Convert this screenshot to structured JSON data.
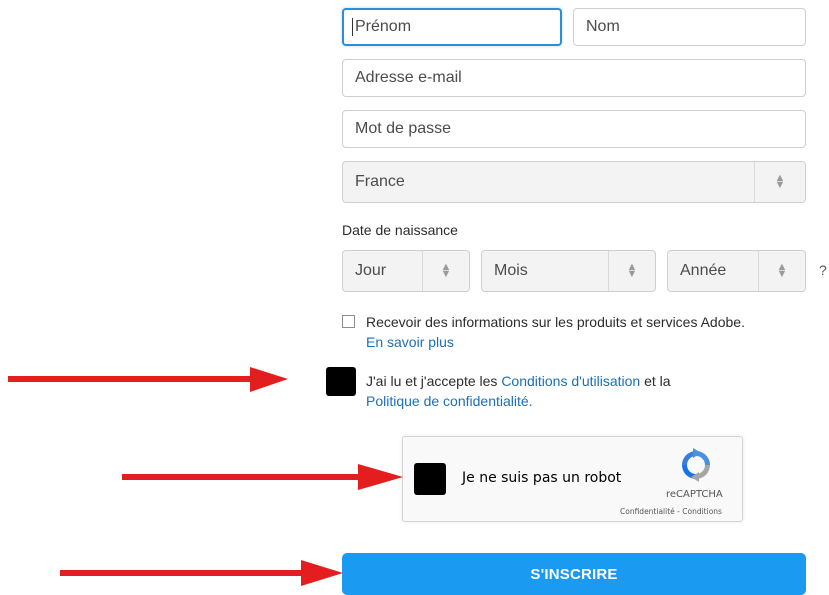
{
  "form": {
    "firstname_placeholder": "Prénom",
    "lastname_placeholder": "Nom",
    "email_placeholder": "Adresse e-mail",
    "password_placeholder": "Mot de passe",
    "country_value": "France",
    "birthdate_label": "Date de naissance",
    "day_value": "Jour",
    "month_value": "Mois",
    "year_value": "Année",
    "help_mark": "?"
  },
  "consent": {
    "newsletter_text": "Recevoir des informations sur les produits et services Adobe.",
    "learn_more_link": "En savoir plus",
    "terms_prefix": "J'ai lu et j'accepte les ",
    "terms_link": "Conditions d'utilisation",
    "terms_and": " et la",
    "privacy_link": "Politique de confidentialité",
    "terms_period": "."
  },
  "recaptcha": {
    "label": "Je ne suis pas un robot",
    "brand": "reCAPTCHA",
    "terms": "Confidentialité - Conditions"
  },
  "submit_label": "S'INSCRIRE",
  "colors": {
    "arrow": "#e41e1e",
    "primary_button": "#1a9af0",
    "link": "#1c6fb7",
    "focus_border": "#2d8ed8"
  }
}
